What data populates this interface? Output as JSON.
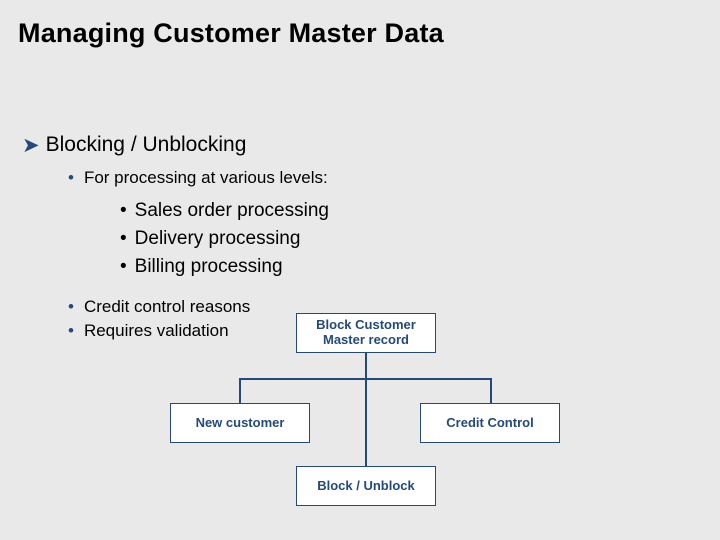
{
  "title": "Managing Customer Master Data",
  "level1": {
    "chevron": "➤",
    "heading": "Blocking / Unblocking"
  },
  "level2": {
    "a": "For processing at various levels:",
    "d": "Credit control reasons",
    "e": "Requires validation"
  },
  "level3": {
    "a": "Sales order processing",
    "b": "Delivery processing",
    "c": "Billing processing"
  },
  "bullets": {
    "dot": "•",
    "round": "•"
  },
  "diagram": {
    "top": "Block Customer\nMaster record",
    "left": "New customer",
    "right": "Credit Control",
    "bottom": "Block / Unblock"
  }
}
